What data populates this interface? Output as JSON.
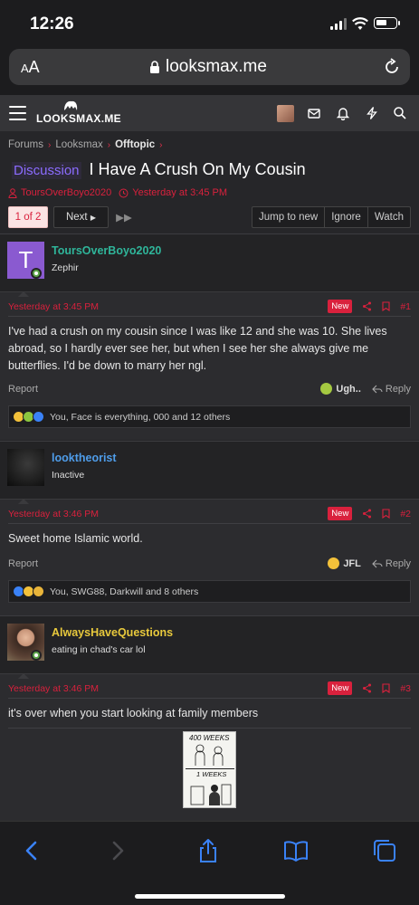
{
  "status": {
    "time": "12:26"
  },
  "browser": {
    "aa_small": "A",
    "aa_big": "A",
    "url": "looksmax.me"
  },
  "site": {
    "logo_text": "LOOKSMAX.ME"
  },
  "breadcrumb": {
    "items": [
      "Forums",
      "Looksmax",
      "Offtopic"
    ]
  },
  "thread": {
    "prefix": "Discussion",
    "title": "I Have A Crush On My Cousin",
    "author": "ToursOverBoyo2020",
    "time": "Yesterday at 3:45 PM"
  },
  "pager": {
    "current": "1 of 2",
    "next": "Next"
  },
  "thread_actions": {
    "jump": "Jump to new",
    "ignore": "Ignore",
    "watch": "Watch"
  },
  "posts": [
    {
      "username": "ToursOverBoyo2020",
      "user_title": "Zephir",
      "avatar_letter": "T",
      "time": "Yesterday at 3:45 PM",
      "badge": "New",
      "number": "#1",
      "message": "I've had a crush on my cousin since I was like 12 and she was 10. She lives abroad, so I hardly ever see her, but when I see her she always give me butterflies. I'd be down to marry her ngl.",
      "report": "Report",
      "reaction_label": "Ugh..",
      "reply": "Reply",
      "reactions": "You, Face is everything, 000 and 12 others"
    },
    {
      "username": "looktheorist",
      "user_title": "Inactive",
      "time": "Yesterday at 3:46 PM",
      "badge": "New",
      "number": "#2",
      "message": "Sweet home Islamic world.",
      "report": "Report",
      "reaction_label": "JFL",
      "reply": "Reply",
      "reactions": "You, SWG88, Darkwill and 8 others"
    },
    {
      "username": "AlwaysHaveQuestions",
      "user_title": "eating in chad's car lol",
      "time": "Yesterday at 3:46 PM",
      "badge": "New",
      "number": "#3",
      "message": "it's over when you start looking at family members",
      "meme_top": "400 WEEKS",
      "meme_bottom": "1 WEEKS"
    }
  ],
  "colors": {
    "accent": "#d9213d",
    "username_1": "#2fb59a",
    "username_2": "#4f9dea",
    "username_3": "#e8c93c",
    "prefix": "#8b6cff",
    "toolbar_icon": "#3a82f7"
  }
}
